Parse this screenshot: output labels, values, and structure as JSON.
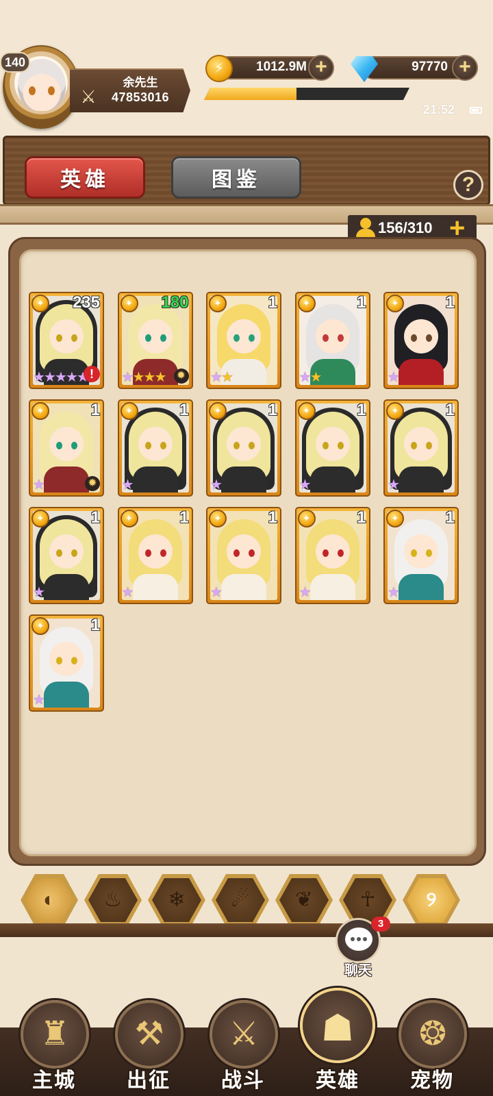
{
  "player": {
    "level": "140",
    "name": "余先生",
    "power": "47853016"
  },
  "resources": {
    "gold": "1012.9M",
    "gems": "97770",
    "exp_fraction": 0.45
  },
  "status_bar": {
    "time": "21:52"
  },
  "tabs": {
    "heroes": "英雄",
    "codex": "图鉴",
    "help": "?"
  },
  "hero_count": {
    "value": "156/310",
    "plus": "+"
  },
  "heroes": [
    {
      "level": "235",
      "stars": [
        "purple",
        "purple",
        "purple",
        "purple",
        "purple"
      ],
      "alert": true,
      "sun": false,
      "level_color": "white",
      "style": "nun"
    },
    {
      "level": "180",
      "stars": [
        "purple",
        "gold",
        "gold",
        "gold"
      ],
      "alert": false,
      "sun": true,
      "level_color": "green",
      "style": "blonde-warrior"
    },
    {
      "level": "1",
      "stars": [
        "purple",
        "gold"
      ],
      "alert": false,
      "sun": false,
      "level_color": "white",
      "style": "blonde-fox"
    },
    {
      "level": "1",
      "stars": [
        "purple",
        "gold"
      ],
      "alert": false,
      "sun": false,
      "level_color": "white",
      "style": "white-hair"
    },
    {
      "level": "1",
      "stars": [
        "purple"
      ],
      "alert": false,
      "sun": false,
      "level_color": "white",
      "style": "black-hair"
    },
    {
      "level": "1",
      "stars": [
        "purple"
      ],
      "alert": false,
      "sun": true,
      "level_color": "white",
      "style": "blonde-warrior"
    },
    {
      "level": "1",
      "stars": [
        "purple"
      ],
      "alert": false,
      "sun": false,
      "level_color": "white",
      "style": "nun"
    },
    {
      "level": "1",
      "stars": [
        "purple"
      ],
      "alert": false,
      "sun": false,
      "level_color": "white",
      "style": "nun"
    },
    {
      "level": "1",
      "stars": [
        "purple"
      ],
      "alert": false,
      "sun": false,
      "level_color": "white",
      "style": "nun"
    },
    {
      "level": "1",
      "stars": [
        "purple"
      ],
      "alert": false,
      "sun": false,
      "level_color": "white",
      "style": "nun"
    },
    {
      "level": "1",
      "stars": [
        "purple"
      ],
      "alert": false,
      "sun": false,
      "level_color": "white",
      "style": "nun"
    },
    {
      "level": "1",
      "stars": [
        "purple"
      ],
      "alert": false,
      "sun": false,
      "level_color": "white",
      "style": "elf"
    },
    {
      "level": "1",
      "stars": [
        "purple"
      ],
      "alert": false,
      "sun": false,
      "level_color": "white",
      "style": "elf"
    },
    {
      "level": "1",
      "stars": [
        "purple"
      ],
      "alert": false,
      "sun": false,
      "level_color": "white",
      "style": "elf"
    },
    {
      "level": "1",
      "stars": [
        "purple"
      ],
      "alert": false,
      "sun": false,
      "level_color": "white",
      "style": "desert"
    },
    {
      "level": "1",
      "stars": [
        "purple"
      ],
      "alert": false,
      "sun": false,
      "level_color": "white",
      "style": "desert"
    }
  ],
  "filters": [
    {
      "name": "all",
      "icon": "◐",
      "state": "active"
    },
    {
      "name": "fire",
      "icon": "♨",
      "state": "normal"
    },
    {
      "name": "ice",
      "icon": "❄",
      "state": "normal"
    },
    {
      "name": "wind",
      "icon": "☄",
      "state": "normal"
    },
    {
      "name": "nature",
      "icon": "❦",
      "state": "normal"
    },
    {
      "name": "dark",
      "icon": "☥",
      "state": "normal"
    },
    {
      "name": "light",
      "icon": "୨",
      "state": "light"
    }
  ],
  "chat": {
    "label": "聊天",
    "badge": "3"
  },
  "bottom_nav": [
    {
      "id": "main-city",
      "label": "主城",
      "icon": "♜",
      "active": false
    },
    {
      "id": "expedition",
      "label": "出征",
      "icon": "⚒",
      "active": false
    },
    {
      "id": "battle",
      "label": "战斗",
      "icon": "⚔",
      "active": false
    },
    {
      "id": "heroes",
      "label": "英雄",
      "icon": "☗",
      "active": true
    },
    {
      "id": "pets",
      "label": "宠物",
      "icon": "❂",
      "active": false
    }
  ],
  "colors": {
    "background": "#f1e4cf",
    "card_gold": "#f5b43a",
    "tab_active": "#d4463c",
    "tab_inactive": "#737373",
    "level_green": "#35d64c",
    "alert_red": "#d8242a"
  }
}
